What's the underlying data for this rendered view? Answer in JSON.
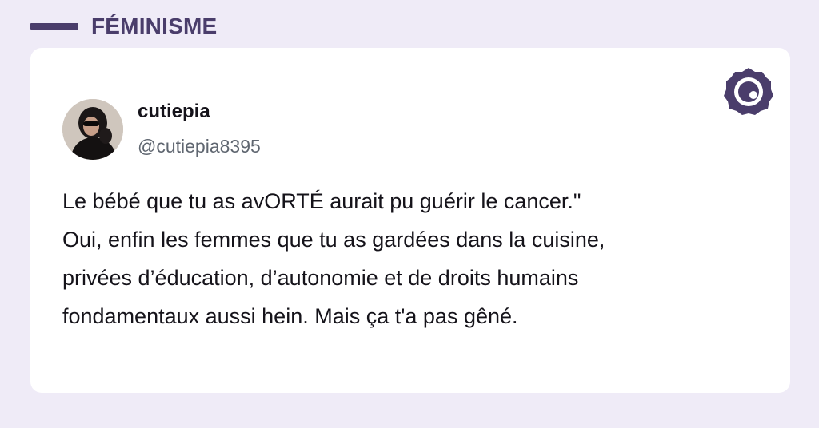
{
  "category": {
    "label": "FÉMINISME"
  },
  "tweet": {
    "author": {
      "display_name": "cutiepia",
      "handle": "@cutiepia8395"
    },
    "lines": [
      "Le bébé que tu as avORTÉ aurait pu guérir le cancer.\"",
      "Oui, enfin les femmes que tu as gardées dans la cuisine,",
      "privées d’éducation, d’autonomie et de droits humains",
      "fondamentaux aussi hein. Mais ça t'a pas gêné."
    ]
  },
  "icons": {
    "brand": "brand-logo-icon",
    "avatar": "avatar-photo"
  },
  "colors": {
    "background": "#efebf7",
    "accent": "#4a3d6b",
    "card": "#ffffff",
    "text": "#15131a",
    "muted": "#5f6670"
  }
}
